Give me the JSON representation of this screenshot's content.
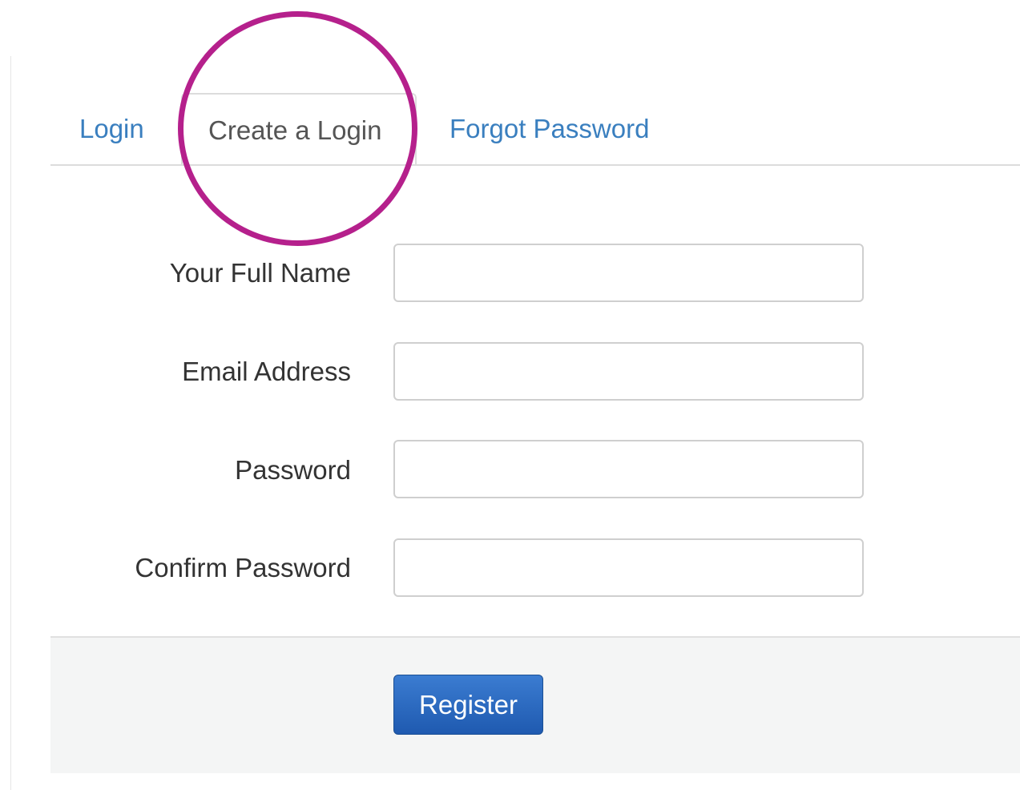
{
  "tabs": {
    "login": "Login",
    "create_login": "Create a Login",
    "forgot_password": "Forgot Password"
  },
  "form": {
    "full_name_label": "Your Full Name",
    "full_name_value": "",
    "email_label": "Email Address",
    "email_value": "",
    "password_label": "Password",
    "password_value": "",
    "confirm_password_label": "Confirm Password",
    "confirm_password_value": ""
  },
  "footer": {
    "register_label": "Register"
  },
  "colors": {
    "link": "#3a7fbf",
    "active_tab_text": "#555555",
    "highlight": "#b5208c",
    "button": "#1f5ab0"
  }
}
